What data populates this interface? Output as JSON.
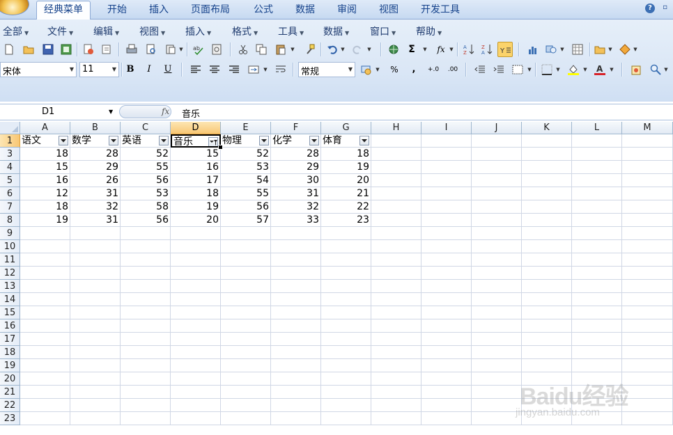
{
  "tabs": {
    "items": [
      {
        "label": "经典菜单",
        "active": true
      },
      {
        "label": "开始"
      },
      {
        "label": "插入"
      },
      {
        "label": "页面布局"
      },
      {
        "label": "公式"
      },
      {
        "label": "数据"
      },
      {
        "label": "审阅"
      },
      {
        "label": "视图"
      },
      {
        "label": "开发工具"
      }
    ],
    "help_label": "?"
  },
  "menubar": {
    "items": [
      "全部",
      "文件",
      "编辑",
      "视图",
      "插入",
      "格式",
      "工具",
      "数据",
      "窗口",
      "帮助"
    ]
  },
  "toolbar": {
    "font_name": "宋体",
    "font_size": "11",
    "number_format": "常规",
    "bold_label": "B",
    "italic_label": "I",
    "underline_label": "U",
    "percent_label": "%",
    "comma_label": ",",
    "sum_label": "Σ",
    "fx_label": "fx",
    "inc_decimal_label": "+.0",
    "dec_decimal_label": ".00",
    "font_color": "#d8232a",
    "fill_color": "#ffff00"
  },
  "formula_bar": {
    "name_box": "D1",
    "fx_label": "fx",
    "formula": "音乐"
  },
  "sheet": {
    "columns": [
      "A",
      "B",
      "C",
      "D",
      "E",
      "F",
      "G",
      "H",
      "I",
      "J",
      "K",
      "L",
      "M"
    ],
    "selected_column": "D",
    "row_numbers": [
      "1",
      "3",
      "4",
      "5",
      "6",
      "7",
      "8",
      "9",
      "10",
      "11",
      "12",
      "13",
      "14",
      "15",
      "16",
      "17",
      "18",
      "19",
      "20",
      "21",
      "22",
      "23"
    ],
    "selected_row": "1",
    "headers": [
      "语文",
      "数学",
      "英语",
      "音乐",
      "物理",
      "化学",
      "体育"
    ],
    "active_filter_column": "D",
    "data": [
      [
        "18",
        "28",
        "52",
        "15",
        "52",
        "28",
        "18"
      ],
      [
        "15",
        "29",
        "55",
        "16",
        "53",
        "29",
        "19"
      ],
      [
        "16",
        "26",
        "56",
        "17",
        "54",
        "30",
        "20"
      ],
      [
        "12",
        "31",
        "53",
        "18",
        "55",
        "31",
        "21"
      ],
      [
        "18",
        "32",
        "58",
        "19",
        "56",
        "32",
        "22"
      ],
      [
        "19",
        "31",
        "56",
        "20",
        "57",
        "33",
        "23"
      ]
    ]
  },
  "watermark": {
    "logo": "Baidu经验",
    "url": "jingyan.baidu.com"
  }
}
